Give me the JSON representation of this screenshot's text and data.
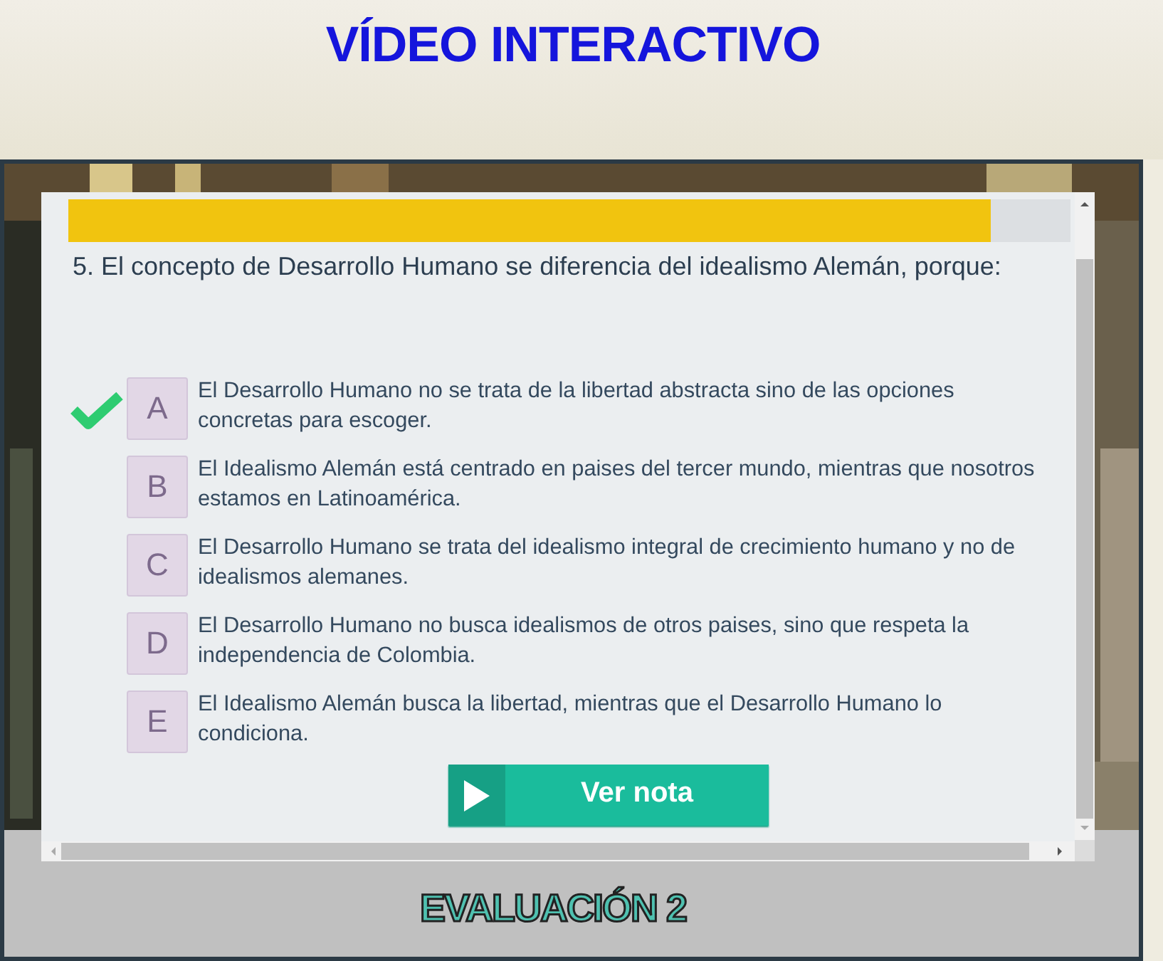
{
  "page": {
    "title": "VÍDEO INTERACTIVO"
  },
  "quiz": {
    "progress": {
      "level": 0.92
    },
    "question": "5. El concepto de Desarrollo Humano se diferencia del idealismo Alemán, porque:",
    "options": [
      {
        "letter": "A",
        "text": "El Desarrollo Humano no se trata de la libertad abstracta sino de las opciones concretas para escoger.",
        "selected": true
      },
      {
        "letter": "B",
        "text": "El Idealismo Alemán está centrado en paises del tercer mundo, mientras que nosotros estamos en Latinoamérica.",
        "selected": false
      },
      {
        "letter": "C",
        "text": "El Desarrollo Humano se trata del idealismo integral de crecimiento humano y no de idealismos alemanes.",
        "selected": false
      },
      {
        "letter": "D",
        "text": "El Desarrollo Humano no busca idealismos de otros paises, sino que respeta la independencia de Colombia.",
        "selected": false
      },
      {
        "letter": "E",
        "text": "El Idealismo Alemán busca la libertad, mientras que el Desarrollo Humano lo condiciona.",
        "selected": false
      }
    ],
    "button": "Ver nota"
  },
  "footer": {
    "label": "EVALUACIÓN 2"
  }
}
